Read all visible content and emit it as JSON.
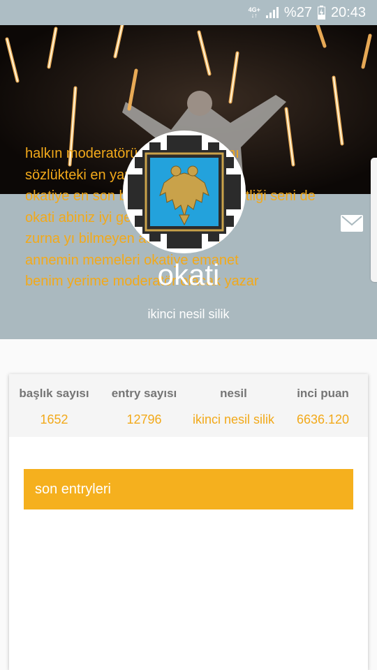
{
  "status_bar": {
    "network": "4G+",
    "battery": "%27",
    "time": "20:43"
  },
  "profile": {
    "username": "okati",
    "subtitle": "ikinci nesil silik"
  },
  "stats": [
    {
      "label": "başlık sayısı",
      "value": "1652"
    },
    {
      "label": "entry sayısı",
      "value": "12796"
    },
    {
      "label": "nesil",
      "value": "ikinci nesil silik"
    },
    {
      "label": "inci puan",
      "value": "6636.120"
    }
  ],
  "entries": {
    "header": "son entryleri",
    "items": [
      "halkın moderatörü ile veda zamanı",
      "sözlükteki en yaratıcı entry",
      "okatiye en son biri bura babamın çiftliği seni de",
      "okati abiniz iyi geceler diler",
      "zurna yı bilmeyen adam değildir",
      "annemin memeleri okatiye emanet",
      "benim yerime moderatör olacak yazar"
    ]
  },
  "colors": {
    "accent": "#f5b01e",
    "profile_band": "#aab9bf",
    "status_bar": "#adbdc4"
  },
  "icons": {
    "mail": "envelope-icon",
    "signal": "signal-icon",
    "battery": "battery-icon"
  }
}
